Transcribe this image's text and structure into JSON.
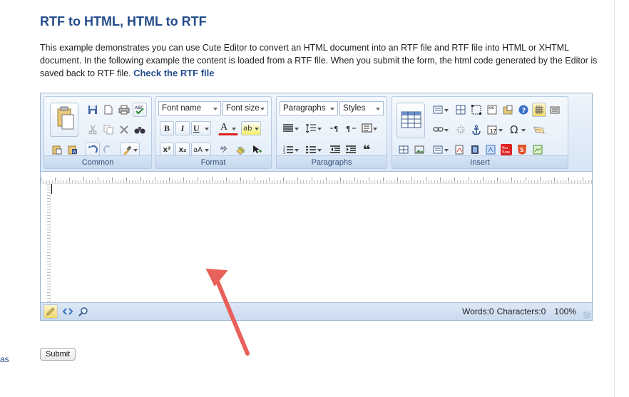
{
  "page": {
    "title": "RTF to HTML, HTML to RTF",
    "description": "This example demonstrates you can use Cute Editor to convert an HTML document into an RTF file and RTF file into HTML or XHTML document. In the following example the content is loaded from a RTF file. When you submit the form, the html code generated by the Editor is saved back to RTF file.",
    "check_link": "Check the RTF file",
    "side_fragment": "as"
  },
  "toolbar": {
    "groups": {
      "common": "Common",
      "format": "Format",
      "paragraphs": "Paragraphs",
      "insert": "Insert"
    },
    "font_name": "Font name",
    "font_size": "Font size",
    "paragraphs_select": "Paragraphs",
    "styles_select": "Styles",
    "bold": "B",
    "italic": "I",
    "underline": "U",
    "font_color": "A",
    "highlight": "ab",
    "superscript": "x²",
    "subscript": "x₂",
    "change_case": "aA",
    "quote": "❝",
    "special_char": "Ω",
    "youtube": "You Tube",
    "html5": "5"
  },
  "status": {
    "words": "Words:0",
    "characters": "Characters:0",
    "zoom": "100%"
  },
  "form": {
    "submit_label": "Submit"
  },
  "colors": {
    "title": "#234c8c",
    "ribbon_border": "#9db4d3",
    "annotation_arrow": "#e8615a"
  }
}
